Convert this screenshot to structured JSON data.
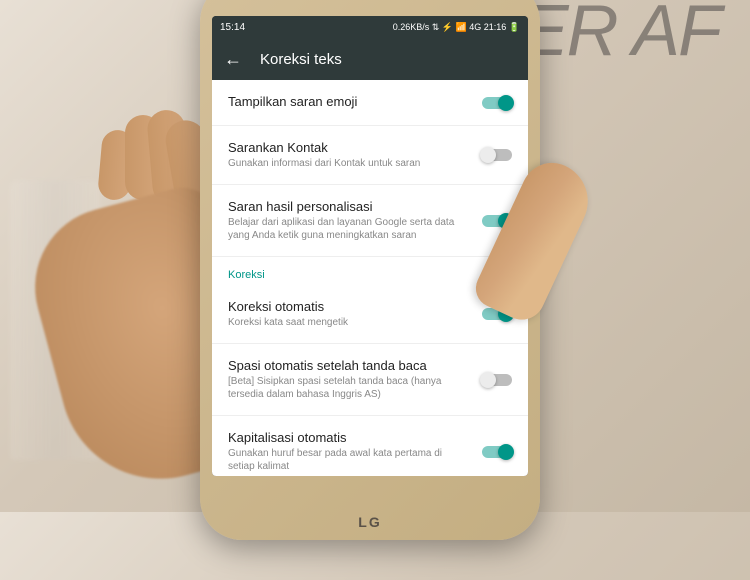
{
  "background": {
    "text": "ASER AF"
  },
  "phone": {
    "brand": "LG"
  },
  "status_bar": {
    "time": "15:14",
    "indicators": "0.26KB/s ⇅ ⚡ 📶 4G 21:16 🔋"
  },
  "header": {
    "back_icon": "←",
    "title": "Koreksi teks"
  },
  "settings": [
    {
      "title": "Tampilkan saran emoji",
      "desc": "",
      "on": true
    },
    {
      "title": "Sarankan Kontak",
      "desc": "Gunakan informasi dari Kontak untuk saran",
      "on": false
    },
    {
      "title": "Saran hasil personalisasi",
      "desc": "Belajar dari aplikasi dan layanan Google serta data yang Anda ketik guna meningkatkan saran",
      "on": true
    }
  ],
  "section_label": "Koreksi",
  "settings2": [
    {
      "title": "Koreksi otomatis",
      "desc": "Koreksi kata saat mengetik",
      "on": true
    },
    {
      "title": "Spasi otomatis setelah tanda baca",
      "desc": "[Beta] Sisipkan spasi setelah tanda baca (hanya tersedia dalam bahasa Inggris AS)",
      "on": false
    },
    {
      "title": "Kapitalisasi otomatis",
      "desc": "Gunakan huruf besar pada awal kata pertama di setiap kalimat",
      "on": true
    }
  ]
}
